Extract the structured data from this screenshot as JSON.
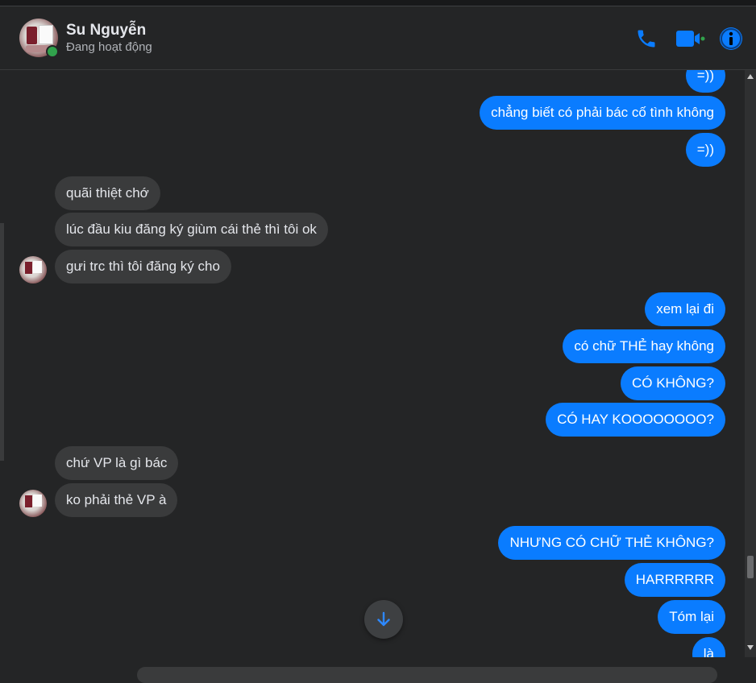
{
  "contact": {
    "name": "Su Nguyễn",
    "status": "Đang hoạt động"
  },
  "header_icons": [
    "phone-icon",
    "video-camera-icon",
    "info-icon"
  ],
  "colors": {
    "outgoing_bubble": "#0a7cff",
    "incoming_bubble": "#3a3b3c",
    "background": "#242526",
    "online": "#31a24c",
    "accent": "#0a7cff"
  },
  "messages": [
    {
      "from": "me",
      "text": "=))"
    },
    {
      "from": "me",
      "text": "chẳng biết có phải bác cố tình không"
    },
    {
      "from": "me",
      "text": "=))"
    },
    {
      "from": "them",
      "text": "quãi thiệt chớ"
    },
    {
      "from": "them",
      "text": "lúc đầu kiu đăng ký giùm cái thẻ thì tôi ok"
    },
    {
      "from": "them",
      "text": "gưi trc thì tôi đăng ký cho"
    },
    {
      "from": "me",
      "text": "xem lại đi"
    },
    {
      "from": "me",
      "text": "có chữ THẺ hay không"
    },
    {
      "from": "me",
      "text": "CÓ KHÔNG?"
    },
    {
      "from": "me",
      "text": "CÓ HAY KOOOOOOOO?"
    },
    {
      "from": "them",
      "text": "chứ VP là gì bác"
    },
    {
      "from": "them",
      "text": "ko phải thẻ VP à"
    },
    {
      "from": "me",
      "text": "NHƯNG CÓ CHỮ THẺ KHÔNG?"
    },
    {
      "from": "me",
      "text": "HARRRRRR"
    },
    {
      "from": "me",
      "text": "Tóm lại"
    },
    {
      "from": "me",
      "text": "là"
    }
  ],
  "scroll_to_bottom_icon": "arrow-down-icon"
}
